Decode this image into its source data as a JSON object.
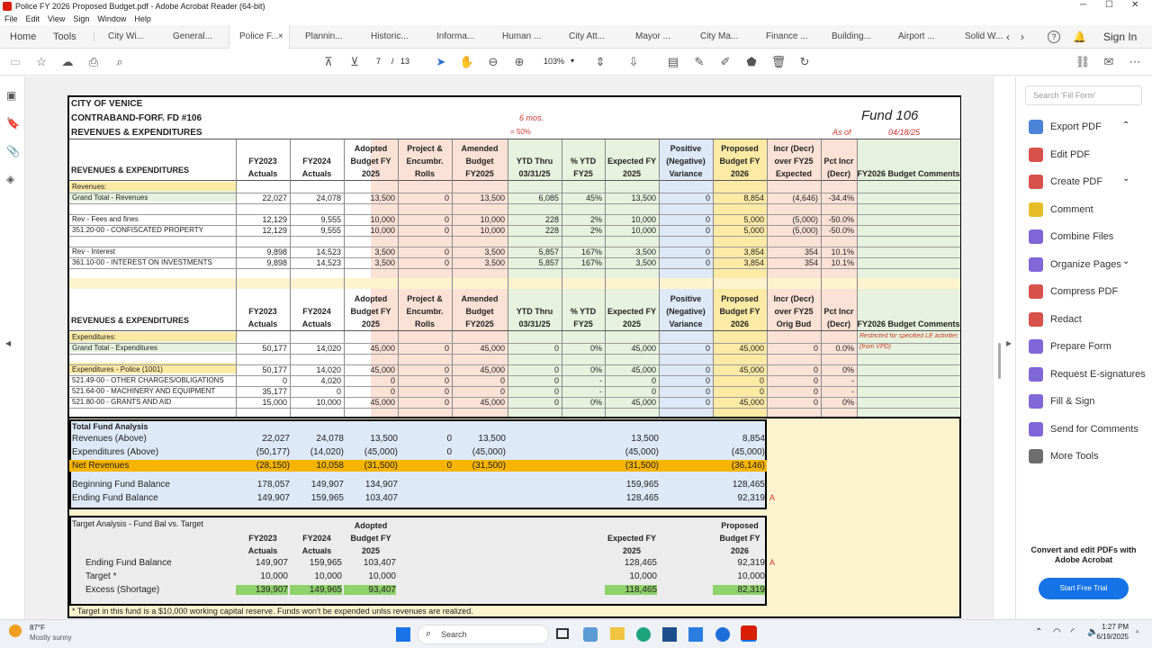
{
  "window": {
    "title": "Police FY 2026 Proposed Budget.pdf - Adobe Acrobat Reader (64-bit)",
    "min": "─",
    "max": "☐",
    "close": "✕"
  },
  "menu": [
    "File",
    "Edit",
    "View",
    "Sign",
    "Window",
    "Help"
  ],
  "tabs": {
    "home": "Home",
    "tools": "Tools",
    "docs": [
      "City Wi...",
      "General...",
      "Police F...",
      "Plannin...",
      "Historic...",
      "Informa...",
      "Human ...",
      "City Att...",
      "Mayor ...",
      "City Ma...",
      "Finance ...",
      "Building...",
      "Airport ...",
      "Solid W..."
    ],
    "close": "×",
    "signin": "Sign In",
    "help": "?"
  },
  "toolbar": {
    "page_current": "7",
    "page_sep": "/",
    "page_total": "13",
    "zoom": "103%"
  },
  "rpanel": {
    "search_placeholder": "Search 'Fill Form'",
    "tools": [
      "Export PDF",
      "Edit PDF",
      "Create PDF",
      "Comment",
      "Combine Files",
      "Organize Pages",
      "Compress PDF",
      "Redact",
      "Prepare Form",
      "Request E-signatures",
      "Fill & Sign",
      "Send for Comments",
      "More Tools"
    ],
    "promo": "Convert and edit PDFs with Adobe Acrobat",
    "trial": "Start Free Trial",
    "colors": [
      "#2c6fd1",
      "#d0342c",
      "#d0342c",
      "#e2b100",
      "#6b4bd1",
      "#6b4bd1",
      "#d0342c",
      "#d0342c",
      "#6b4bd1",
      "#6b4bd1",
      "#6b4bd1",
      "#6b4bd1",
      "#555555"
    ]
  },
  "sheet": {
    "title1": "CITY OF VENICE",
    "title2": "CONTRABAND-FORF. FD #106",
    "title3": "REVENUES & EXPENDITURES",
    "mos": "6 mos.",
    "pct": "= 50%",
    "fund": "Fund 106",
    "asof": "As of",
    "asof_date": "04/18/25",
    "headers1": [
      "REVENUES & EXPENDITURES",
      "FY2023 Actuals",
      "FY2024 Actuals",
      "Adopted Budget FY 2025",
      "Project & Encumbr. Rolls",
      "Amended Budget FY2025",
      "YTD Thru 03/31/25",
      "% YTD FY25",
      "Expected FY 2025",
      "Positive (Negative) Variance",
      "Proposed Budget FY 2026",
      "Incr (Decr) over FY25 Expected",
      "Pct Incr (Decr)",
      "FY2026 Budget Comments"
    ],
    "rev_rows": [
      [
        "Revenues:",
        "",
        "",
        "",
        "",
        "",
        "",
        "",
        "",
        "",
        "",
        "",
        "",
        ""
      ],
      [
        "Grand Total - Revenues",
        "22,027",
        "24,078",
        "13,500",
        "0",
        "13,500",
        "6,085",
        "45%",
        "13,500",
        "0",
        "8,854",
        "(4,646)",
        "-34.4%",
        ""
      ],
      [
        "",
        "",
        "",
        "",
        "",
        "",
        "",
        "",
        "",
        "",
        "",
        "",
        "",
        ""
      ],
      [
        "Rev - Fees and fines",
        "12,129",
        "9,555",
        "10,000",
        "0",
        "10,000",
        "228",
        "2%",
        "10,000",
        "0",
        "5,000",
        "(5,000)",
        "-50.0%",
        ""
      ],
      [
        "351.20-00 - CONFISCATED PROPERTY",
        "12,129",
        "9,555",
        "10,000",
        "0",
        "10,000",
        "228",
        "2%",
        "10,000",
        "0",
        "5,000",
        "(5,000)",
        "-50.0%",
        ""
      ],
      [
        "",
        "",
        "",
        "",
        "",
        "",
        "",
        "",
        "",
        "",
        "",
        "",
        "",
        ""
      ],
      [
        "Rev - Interest",
        "9,898",
        "14,523",
        "3,500",
        "0",
        "3,500",
        "5,857",
        "167%",
        "3,500",
        "0",
        "3,854",
        "354",
        "10.1%",
        ""
      ],
      [
        "361.10-00 - INTEREST ON INVESTMENTS",
        "9,898",
        "14,523",
        "3,500",
        "0",
        "3,500",
        "5,857",
        "167%",
        "3,500",
        "0",
        "3,854",
        "354",
        "10.1%",
        ""
      ]
    ],
    "headers2": [
      "REVENUES & EXPENDITURES",
      "FY2023 Actuals",
      "FY2024 Actuals",
      "Adopted Budget FY 2025",
      "Project & Encumbr. Rolls",
      "Amended Budget FY2025",
      "YTD Thru 03/31/25",
      "% YTD FY25",
      "Expected FY 2025",
      "Positive (Negative) Variance",
      "Proposed Budget FY 2026",
      "Incr (Decr) over FY25 Orig Bud",
      "Pct Incr (Decr)",
      "FY2026 Budget Comments"
    ],
    "exp_rows": [
      [
        "Expenditures:",
        "",
        "",
        "",
        "",
        "",
        "",
        "",
        "",
        "",
        "",
        "",
        "",
        "Restricted for specified LE activities"
      ],
      [
        "Grand Total - Expenditures",
        "50,177",
        "14,020",
        "45,000",
        "0",
        "45,000",
        "0",
        "0%",
        "45,000",
        "0",
        "45,000",
        "0",
        "0.0%",
        "(from VPD)"
      ],
      [
        "",
        "",
        "",
        "",
        "",
        "",
        "",
        "",
        "",
        "",
        "",
        "",
        "",
        ""
      ],
      [
        "Expenditures - Police (1001)",
        "50,177",
        "14,020",
        "45,000",
        "0",
        "45,000",
        "0",
        "0%",
        "45,000",
        "0",
        "45,000",
        "0",
        "0%",
        ""
      ],
      [
        "521.49-00 - OTHER CHARGES/OBLIGATIONS",
        "0",
        "4,020",
        "0",
        "0",
        "0",
        "0",
        "-",
        "0",
        "0",
        "0",
        "0",
        "-",
        ""
      ],
      [
        "521.64-00 - MACHINERY AND EQUIPMENT",
        "35,177",
        "0",
        "0",
        "0",
        "0",
        "0",
        "-",
        "0",
        "0",
        "0",
        "0",
        "-",
        ""
      ],
      [
        "521.80-00 - GRANTS AND AID",
        "15,000",
        "10,000",
        "45,000",
        "0",
        "45,000",
        "0",
        "0%",
        "45,000",
        "0",
        "45,000",
        "0",
        "0%",
        ""
      ]
    ],
    "tfa_title": "Total Fund Analysis",
    "tfa_rows": [
      [
        "Revenues (Above)",
        "22,027",
        "24,078",
        "13,500",
        "0",
        "13,500",
        "13,500",
        "8,854"
      ],
      [
        "Expenditures (Above)",
        "(50,177)",
        "(14,020)",
        "(45,000)",
        "0",
        "(45,000)",
        "(45,000)",
        "(45,000)"
      ],
      [
        "Net Revenues",
        "(28,150)",
        "10,058",
        "(31,500)",
        "0",
        "(31,500)",
        "(31,500)",
        "(36,146)"
      ],
      [
        "Beginning Fund Balance",
        "178,057",
        "149,907",
        "134,907",
        "",
        "",
        "159,965",
        "128,465"
      ],
      [
        "Ending Fund Balance",
        "149,907",
        "159,965",
        "103,407",
        "",
        "",
        "128,465",
        "92,319"
      ]
    ],
    "flagA": "A",
    "ta_title": "Target Analysis - Fund Bal vs. Target",
    "ta_headers": [
      "FY2023 Actuals",
      "FY2024 Actuals",
      "Adopted Budget FY 2025",
      "Expected FY 2025",
      "Proposed Budget FY 2026"
    ],
    "ta_rows": [
      [
        "Ending Fund Balance",
        "149,907",
        "159,965",
        "103,407",
        "128,465",
        "92,319"
      ],
      [
        "Target *",
        "10,000",
        "10,000",
        "10,000",
        "10,000",
        "10,000"
      ],
      [
        "Excess (Shortage)",
        "139,907",
        "149,965",
        "93,407",
        "118,465",
        "82,319"
      ]
    ],
    "footnote": "* Target in this fund is a $10,000 working capital reserve. Funds won't be expended unlss revenues are realized."
  },
  "taskbar": {
    "temp": "87°F",
    "weather": "Mostly sunny",
    "search": "Search",
    "time": "1:27 PM",
    "date": "6/19/2025"
  }
}
